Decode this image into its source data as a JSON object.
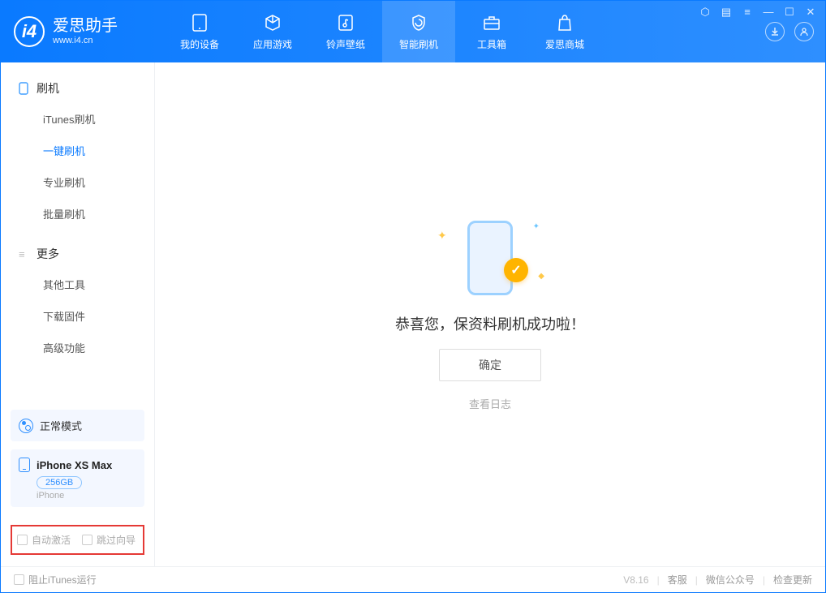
{
  "app": {
    "name": "爱思助手",
    "site": "www.i4.cn"
  },
  "nav": [
    {
      "label": "我的设备"
    },
    {
      "label": "应用游戏"
    },
    {
      "label": "铃声壁纸"
    },
    {
      "label": "智能刷机"
    },
    {
      "label": "工具箱"
    },
    {
      "label": "爱思商城"
    }
  ],
  "sidebar": {
    "group1": {
      "title": "刷机",
      "items": [
        "iTunes刷机",
        "一键刷机",
        "专业刷机",
        "批量刷机"
      ]
    },
    "group2": {
      "title": "更多",
      "items": [
        "其他工具",
        "下载固件",
        "高级功能"
      ]
    },
    "status_label": "正常模式",
    "device": {
      "name": "iPhone XS Max",
      "capacity": "256GB",
      "type": "iPhone"
    },
    "check1": "自动激活",
    "check2": "跳过向导"
  },
  "main": {
    "success_message": "恭喜您，保资料刷机成功啦！",
    "ok_button": "确定",
    "view_log": "查看日志"
  },
  "footer": {
    "block_itunes": "阻止iTunes运行",
    "version": "V8.16",
    "link1": "客服",
    "link2": "微信公众号",
    "link3": "检查更新"
  }
}
